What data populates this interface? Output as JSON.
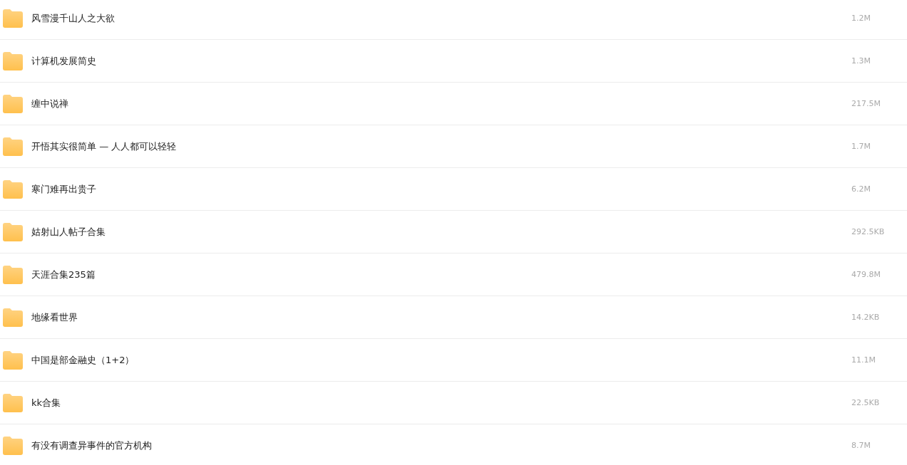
{
  "files": [
    {
      "name": "风雪漫千山人之大欲",
      "size": "1.2M"
    },
    {
      "name": "计算机发展简史",
      "size": "1.3M"
    },
    {
      "name": "缠中说禅",
      "size": "217.5M"
    },
    {
      "name": "开悟其实很简单 — 人人都可以轻轻",
      "size": "1.7M"
    },
    {
      "name": "寒门难再出贵子",
      "size": "6.2M"
    },
    {
      "name": "姑射山人帖子合集",
      "size": "292.5KB"
    },
    {
      "name": "天涯合集235篇",
      "size": "479.8M"
    },
    {
      "name": "地缘看世界",
      "size": "14.2KB"
    },
    {
      "name": "中国是部金融史（1+2）",
      "size": "11.1M"
    },
    {
      "name": "kk合集",
      "size": "22.5KB"
    },
    {
      "name": "有没有调查异事件的官方机构",
      "size": "8.7M"
    }
  ]
}
